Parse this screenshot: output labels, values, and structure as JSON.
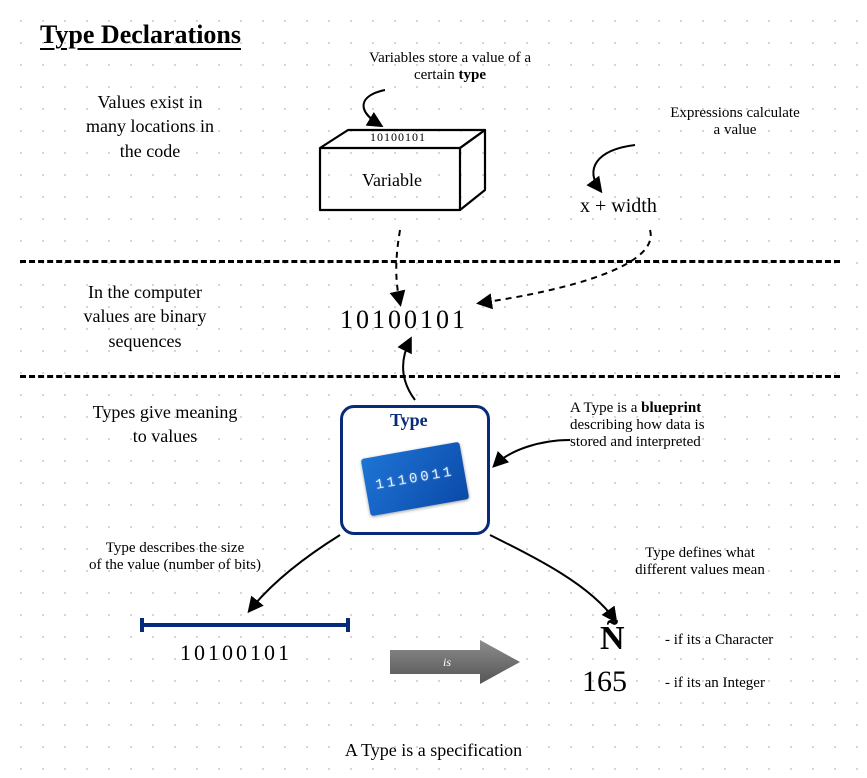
{
  "title": "Type Declarations",
  "section1": {
    "left_text": "Values exist in\nmany locations in\nthe code",
    "top_note": "Variables store a value of a\ncertain ",
    "top_note_bold": "type",
    "variable_label": "Variable",
    "variable_binary": "10100101",
    "expr_note": "Expressions calculate\na value",
    "expr": "x + width"
  },
  "section2": {
    "left_text": "In the computer\nvalues are binary\nsequences",
    "binary": "10100101"
  },
  "section3": {
    "left_text": "Types give meaning\nto values",
    "type_label": "Type",
    "chip_text": "1110011",
    "blueprint_pre": "A Type is a ",
    "blueprint_bold": "blueprint",
    "blueprint_post": "\ndescribing how data is\nstored and interpreted",
    "size_note": "Type describes the size\nof the value (number of bits)",
    "size_binary": "10100101",
    "meaning_note": "Type defines what\ndifferent values mean",
    "is_label": "is",
    "char_value": "Ñ",
    "char_note": "- if its a Character",
    "int_value": "165",
    "int_note": "- if its an Integer",
    "footer": "A Type is a specification"
  }
}
